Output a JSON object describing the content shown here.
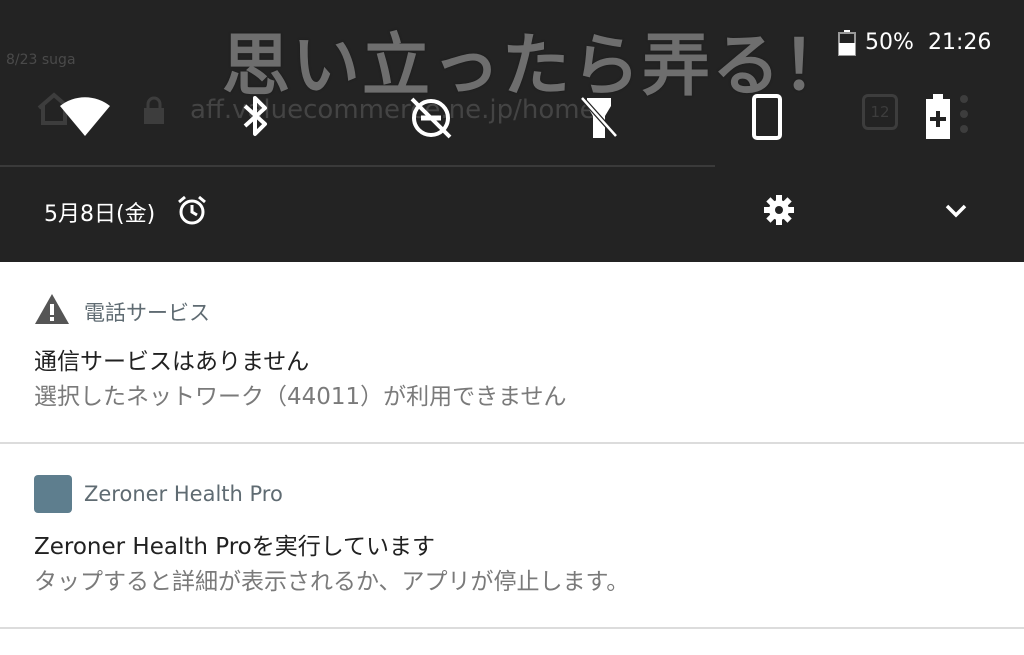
{
  "caption": "思い立ったら弄る！",
  "status_bar": {
    "battery": "50%",
    "time": "21:26"
  },
  "background_app": {
    "url": "aff.valuecommerce.ne.jp/home",
    "tab_count": "12",
    "small_text": "8/23 suga"
  },
  "quick_settings": {
    "tiles": [
      {
        "name": "wifi",
        "icon": "wifi-icon"
      },
      {
        "name": "bluetooth",
        "icon": "bluetooth-icon"
      },
      {
        "name": "do-not-disturb",
        "icon": "dnd-off-icon"
      },
      {
        "name": "flashlight",
        "icon": "flashlight-off-icon"
      },
      {
        "name": "auto-rotate",
        "icon": "phone-rotate-icon"
      },
      {
        "name": "battery-saver",
        "icon": "battery-plus-icon"
      }
    ],
    "date": "5月8日(金)",
    "icons": {
      "alarm": "alarm-clock-icon",
      "settings": "gear-icon",
      "expand": "chevron-down-icon"
    }
  },
  "notifications": [
    {
      "app": "電話サービス",
      "icon": "warning-icon",
      "title": "通信サービスはありません",
      "text": "選択したネットワーク（44011）が利用できません"
    },
    {
      "app": "Zeroner Health Pro",
      "icon": "app-square-icon",
      "title": "Zeroner Health Proを実行しています",
      "text": "タップすると詳細が表示されるか、アプリが停止します。"
    }
  ],
  "colors": {
    "shade_bg": "#232323",
    "app_icon": "#5e7e8e"
  }
}
